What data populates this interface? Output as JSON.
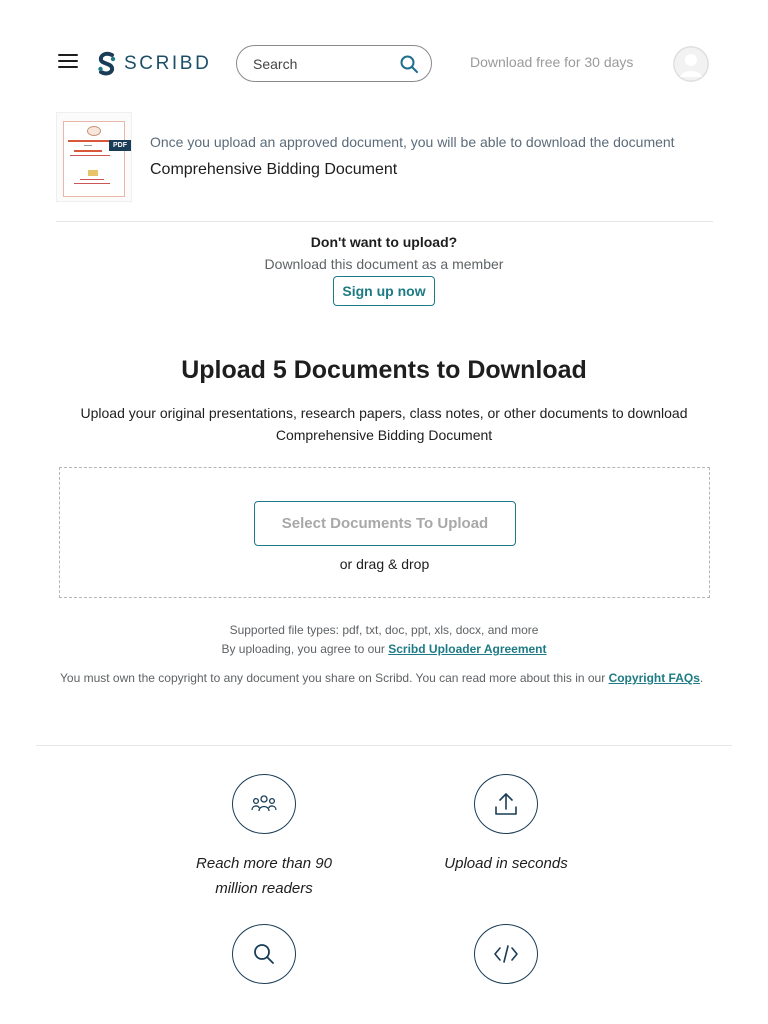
{
  "header": {
    "logo_text": "SCRIBD",
    "search_placeholder": "Search",
    "download_free": "Download free for 30 days"
  },
  "document": {
    "notice": "Once you upload an approved document, you will be able to download the document",
    "title": "Comprehensive Bidding Document",
    "thumb_badge": "PDF"
  },
  "alternative": {
    "title": "Don't want to upload?",
    "subtitle": "Download this document as a member",
    "signup_label": "Sign up now"
  },
  "upload": {
    "heading": "Upload 5 Documents to Download",
    "description": "Upload your original presentations, research papers, class notes, or other documents to download Comprehensive Bidding Document",
    "select_label": "Select Documents To Upload",
    "drag_drop": "or drag & drop",
    "filetypes": "Supported file types: pdf, txt, doc, ppt, xls, docx, and more",
    "agree_prefix": "By uploading, you agree to our ",
    "agree_link": "Scribd Uploader Agreement",
    "copyright_text": "You must own the copyright to any document you share on Scribd. You can read more about this in our ",
    "copyright_link": "Copyright FAQs",
    "copyright_suffix": "."
  },
  "features": [
    {
      "label": "Reach more than 90 million readers",
      "icon": "people-icon"
    },
    {
      "label": "Upload in seconds",
      "icon": "upload-icon"
    },
    {
      "label": "",
      "icon": "search-icon"
    },
    {
      "label": "",
      "icon": "code-icon"
    }
  ],
  "colors": {
    "accent": "#1e7b85",
    "navy": "#1a3d57",
    "muted": "#5f6366"
  }
}
